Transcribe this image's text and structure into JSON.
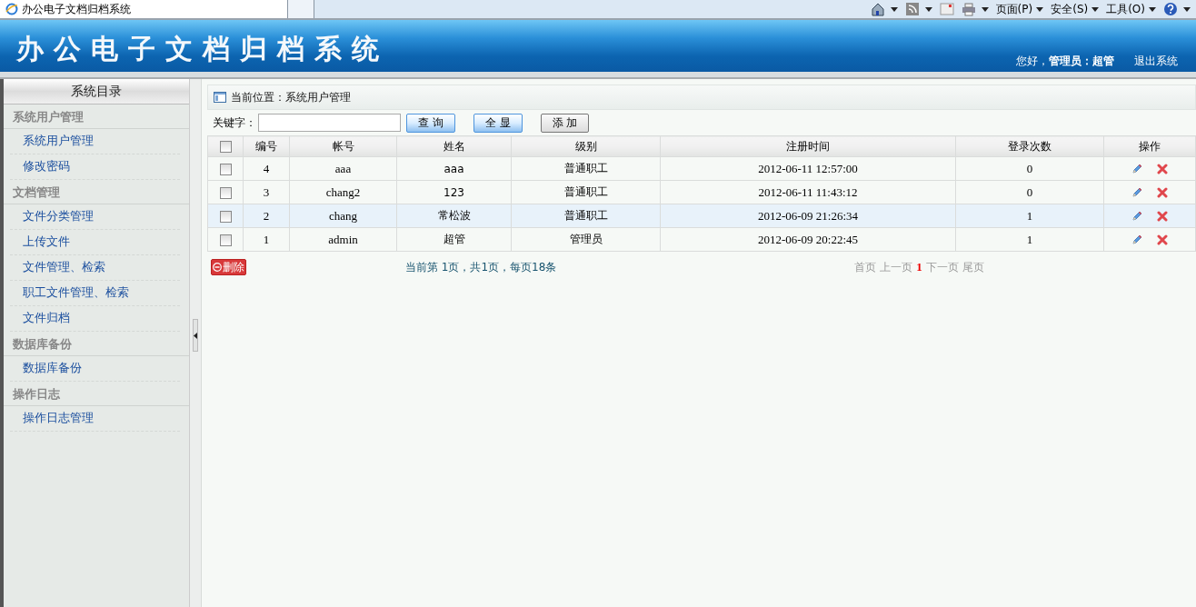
{
  "browser": {
    "tab_title": "办公电子文档归档系统",
    "menus": [
      "页面(P)",
      "安全(S)",
      "工具(O)"
    ]
  },
  "header": {
    "title": "办公电子文档归档系统",
    "greeting": "您好，**管理员：超管**",
    "logout": "退出系统"
  },
  "sidebar": {
    "title": "系统目录",
    "sections": [
      {
        "label": "系统用户管理",
        "items": [
          "系统用户管理",
          "修改密码"
        ]
      },
      {
        "label": "文档管理",
        "items": [
          "文件分类管理",
          "上传文件",
          "文件管理、检索",
          "职工文件管理、检索",
          "文件归档"
        ]
      },
      {
        "label": "数据库备份",
        "items": [
          "数据库备份"
        ]
      },
      {
        "label": "操作日志",
        "items": [
          "操作日志管理"
        ]
      }
    ]
  },
  "breadcrumb": "当前位置：系统用户管理",
  "search": {
    "label": "关键字：",
    "buttons": [
      {
        "label": "查 询",
        "kind": "primary"
      },
      {
        "label": "全 显",
        "kind": "primary"
      },
      {
        "label": "添 加",
        "kind": "plain"
      }
    ]
  },
  "table": {
    "select_all_checked": false,
    "columns": [
      "编号",
      "帐号",
      "姓名",
      "级别",
      "注册时间",
      "登录次数",
      "操作"
    ],
    "rows": [
      {
        "checked": false,
        "highlighted": false,
        "cells": [
          "4",
          "aaa",
          "aaa",
          "普通职工",
          "2012-06-11 12:57:00",
          "0"
        ]
      },
      {
        "checked": false,
        "highlighted": false,
        "cells": [
          "3",
          "chang2",
          "123",
          "普通职工",
          "2012-06-11 11:43:12",
          "0"
        ]
      },
      {
        "checked": false,
        "highlighted": true,
        "cells": [
          "2",
          "chang",
          "常松波",
          "普通职工",
          "2012-06-09 21:26:34",
          "1"
        ]
      },
      {
        "checked": false,
        "highlighted": false,
        "cells": [
          "1",
          "admin",
          "超管",
          "管理员",
          "2012-06-09 20:22:45",
          "1"
        ]
      }
    ]
  },
  "footer": {
    "delete_button": "删除",
    "page_info": "当前第 1页，共1页，每页18条",
    "pager": [
      {
        "label": "首页",
        "kind": "disabled"
      },
      {
        "label": "上一页",
        "kind": "disabled"
      },
      {
        "label": "1",
        "kind": "current"
      },
      {
        "label": "下一页",
        "kind": "disabled"
      },
      {
        "label": "尾页",
        "kind": "disabled"
      }
    ]
  }
}
